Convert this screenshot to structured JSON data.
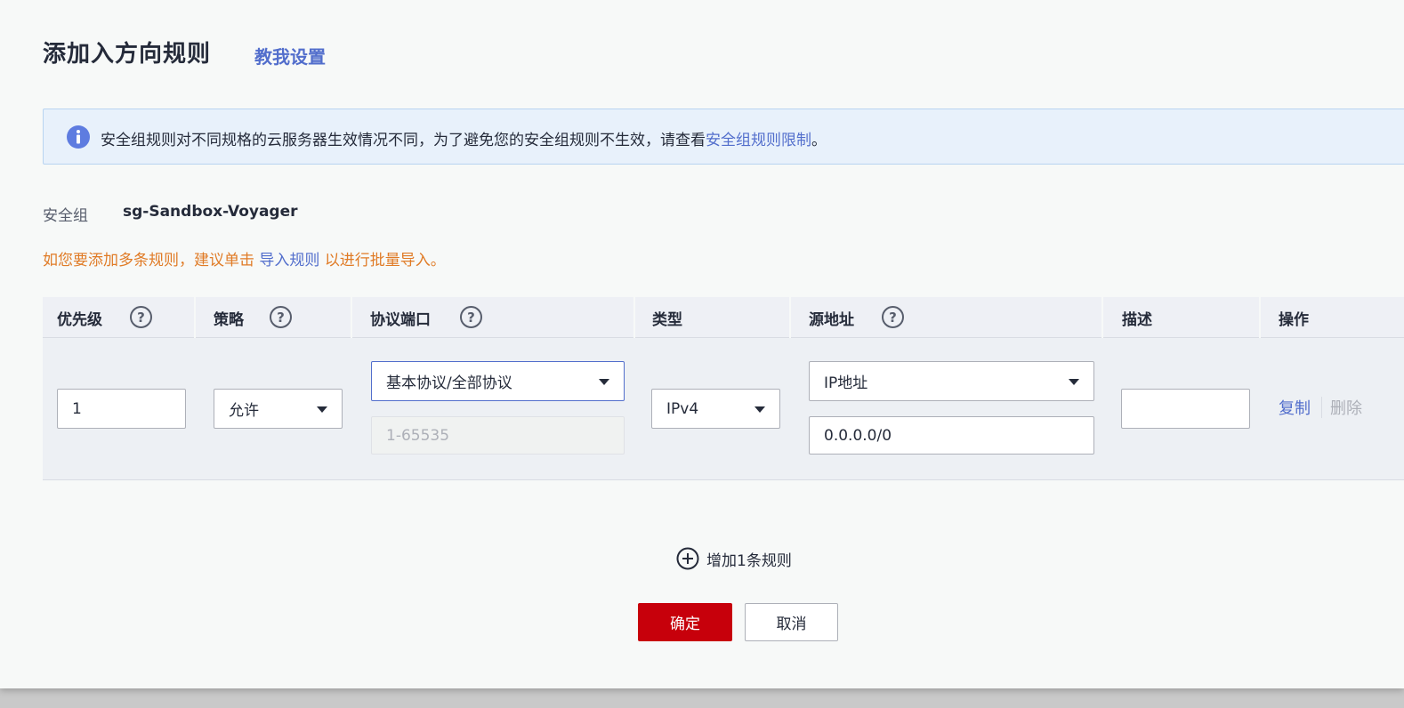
{
  "dialog": {
    "title": "添加入方向规则",
    "help_link": "教我设置"
  },
  "notice": {
    "text": "安全组规则对不同规格的云服务器生效情况不同，为了避免您的安全组规则不生效，请查看",
    "link": "安全组规则限制",
    "suffix": "。",
    "icon": "info-icon"
  },
  "security_group": {
    "label": "安全组",
    "value": "sg-Sandbox-Voyager"
  },
  "tip": {
    "prefix": "如您要添加多条规则，建议单击",
    "link": "导入规则",
    "suffix": "以进行批量导入。"
  },
  "table": {
    "headers": {
      "priority": "优先级",
      "policy": "策略",
      "protocol_port": "协议端口",
      "type": "类型",
      "source": "源地址",
      "description": "描述",
      "actions": "操作"
    },
    "help_mark": "?",
    "row": {
      "priority": "1",
      "policy": "允许",
      "protocol": "基本协议/全部协议",
      "port": "1-65535",
      "type": "IPv4",
      "source_type": "IP地址",
      "source_value": "0.0.0.0/0",
      "description": "",
      "copy": "复制",
      "delete": "删除"
    }
  },
  "add_rule": "增加1条规则",
  "buttons": {
    "ok": "确定",
    "cancel": "取消"
  },
  "colors": {
    "link": "#526ecc",
    "primary": "#c7000b",
    "tip": "#e07b26",
    "info": "#5e7ce0"
  }
}
